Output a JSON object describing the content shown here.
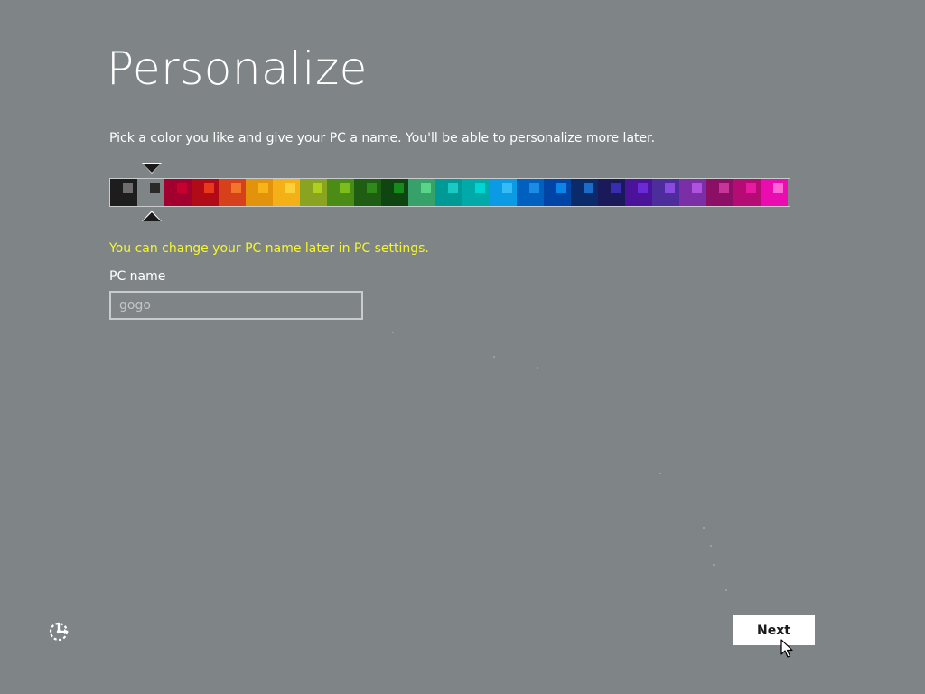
{
  "page": {
    "title": "Personalize",
    "subtitle": "Pick a color you like and give your PC a name. You'll be able to personalize more later.",
    "hint": "You can change your PC name later in PC settings.",
    "hint_color": "#f5f72a",
    "background_color": "#7f8487"
  },
  "palette": {
    "selected_index": 1,
    "selection_marker": "triangle-marker-icons",
    "swatches": [
      {
        "bg": "#1d1d1d",
        "accent": "#6d6d6d"
      },
      {
        "bg": "#7f8487",
        "accent": "#2a2a2a"
      },
      {
        "bg": "#a2002e",
        "accent": "#c8002f"
      },
      {
        "bg": "#b10b17",
        "accent": "#e8391a"
      },
      {
        "bg": "#d6401b",
        "accent": "#f2762a"
      },
      {
        "bg": "#e2920b",
        "accent": "#f6b419"
      },
      {
        "bg": "#f3b017",
        "accent": "#fbd13a"
      },
      {
        "bg": "#8aa321",
        "accent": "#b0d020"
      },
      {
        "bg": "#4a8c15",
        "accent": "#7cbd1c"
      },
      {
        "bg": "#1e5d12",
        "accent": "#2e8a1a"
      },
      {
        "bg": "#0e4510",
        "accent": "#168b1b"
      },
      {
        "bg": "#36a26a",
        "accent": "#5ad488"
      },
      {
        "bg": "#009a96",
        "accent": "#1bc9c4"
      },
      {
        "bg": "#00aaa8",
        "accent": "#00d6d1"
      },
      {
        "bg": "#0a9be4",
        "accent": "#35bbf5"
      },
      {
        "bg": "#0060c0",
        "accent": "#1a8ce6"
      },
      {
        "bg": "#0044a6",
        "accent": "#0a86e8"
      },
      {
        "bg": "#0b2a6a",
        "accent": "#1b6cc8"
      },
      {
        "bg": "#1a1a5a",
        "accent": "#3a2cb0"
      },
      {
        "bg": "#4b139a",
        "accent": "#6a2ad6"
      },
      {
        "bg": "#4d2c9c",
        "accent": "#8b4adf"
      },
      {
        "bg": "#7a2fa6",
        "accent": "#b052e0"
      },
      {
        "bg": "#8b0f64",
        "accent": "#c83598"
      },
      {
        "bg": "#b40c74",
        "accent": "#e81aa0"
      },
      {
        "bg": "#ea0cb1",
        "accent": "#ff66d6"
      }
    ]
  },
  "form": {
    "pc_name_label": "PC name",
    "pc_name_value": "gogo"
  },
  "footer": {
    "ease_of_access_icon": "ease-of-access-icon",
    "next_label": "Next",
    "cursor_icon": "arrow-pointer-icon"
  }
}
